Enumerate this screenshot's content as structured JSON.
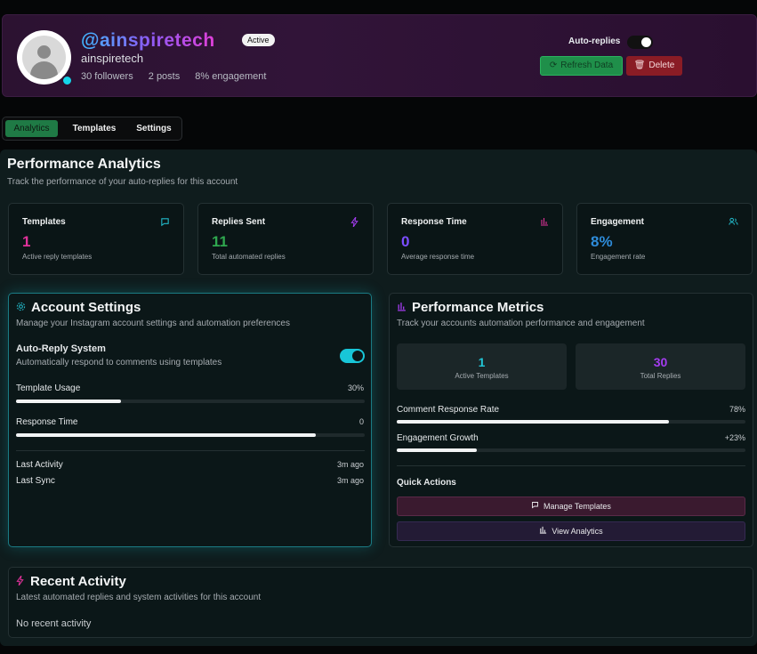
{
  "header": {
    "handle": "@ainspiretech",
    "status_badge": "Active",
    "username": "ainspiretech",
    "followers": "30 followers",
    "posts": "2 posts",
    "engagement": "8% engagement",
    "auto_replies_label": "Auto-replies",
    "auto_replies_on": true,
    "refresh_label": "Refresh Data",
    "delete_label": "Delete"
  },
  "tabs": [
    {
      "label": "Analytics",
      "active": true
    },
    {
      "label": "Templates",
      "active": false
    },
    {
      "label": "Settings",
      "active": false
    }
  ],
  "analytics": {
    "title": "Performance Analytics",
    "subtitle": "Track the performance of your auto-replies for this account",
    "cards": [
      {
        "label": "Templates",
        "value": "1",
        "desc": "Active reply templates",
        "icon": "message-icon",
        "color": "#e0329a"
      },
      {
        "label": "Replies Sent",
        "value": "11",
        "desc": "Total automated replies",
        "icon": "bolt-icon",
        "color": "#2fa84f"
      },
      {
        "label": "Response Time",
        "value": "0",
        "desc": "Average response time",
        "icon": "bar-chart-icon",
        "color": "#7b4dff"
      },
      {
        "label": "Engagement",
        "value": "8%",
        "desc": "Engagement rate",
        "icon": "users-icon",
        "color": "#2e8bd9"
      }
    ]
  },
  "account_settings": {
    "title": "Account Settings",
    "subtitle": "Manage your Instagram account settings and automation preferences",
    "auto_reply_title": "Auto-Reply System",
    "auto_reply_desc": "Automatically respond to comments using templates",
    "auto_reply_on": true,
    "template_usage_label": "Template Usage",
    "template_usage_value": "30%",
    "template_usage_fraction": 0.3,
    "response_time_label": "Response Time",
    "response_time_value": "0",
    "response_time_fraction": 0.86,
    "last_activity_label": "Last Activity",
    "last_activity_value": "3m ago",
    "last_sync_label": "Last Sync",
    "last_sync_value": "3m ago"
  },
  "performance_metrics": {
    "title": "Performance Metrics",
    "subtitle": "Track your accounts automation performance and engagement",
    "active_templates_value": "1",
    "active_templates_label": "Active Templates",
    "total_replies_value": "30",
    "total_replies_label": "Total Replies",
    "comment_rate_label": "Comment Response Rate",
    "comment_rate_value": "78%",
    "comment_rate_fraction": 0.78,
    "engagement_growth_label": "Engagement Growth",
    "engagement_growth_value": "+23%",
    "engagement_growth_fraction": 0.23,
    "quick_actions_label": "Quick Actions",
    "manage_templates_label": "Manage Templates",
    "view_analytics_label": "View Analytics"
  },
  "recent_activity": {
    "title": "Recent Activity",
    "subtitle": "Latest automated replies and system activities for this account",
    "empty_text": "No recent activity"
  },
  "colors": {
    "accent_cyan": "#14d6ea",
    "accent_green": "#1f8f4a",
    "accent_red": "#8a1c25",
    "accent_purple": "#a43cf0"
  }
}
